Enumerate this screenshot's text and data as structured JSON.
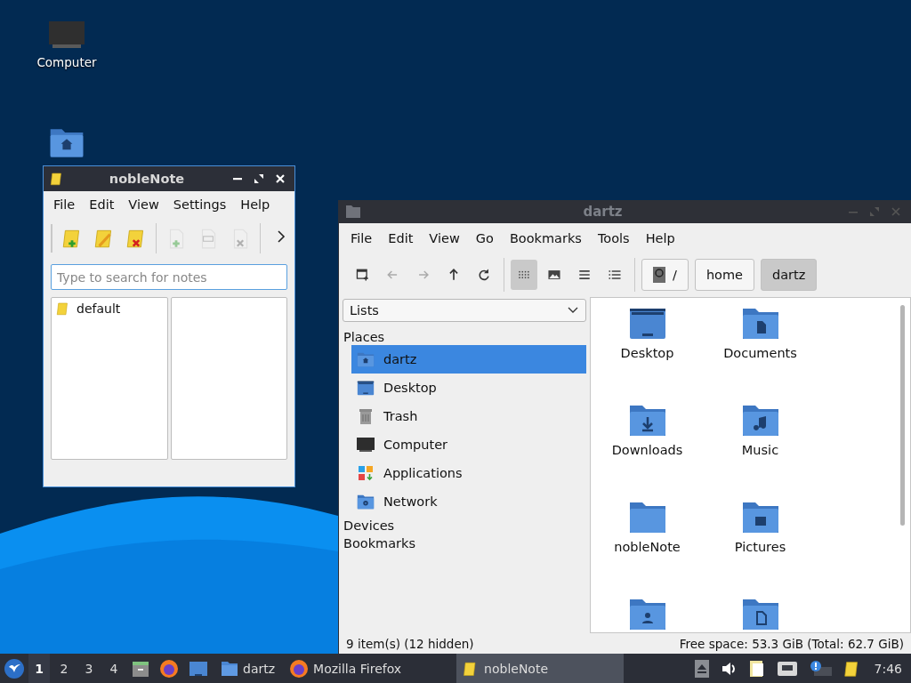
{
  "desktop": {
    "icons": [
      {
        "kind": "computer",
        "label": "Computer"
      },
      {
        "kind": "home"
      }
    ]
  },
  "notes_window": {
    "title": "nobleNote",
    "menu": [
      "File",
      "Edit",
      "View",
      "Settings",
      "Help"
    ],
    "toolbar": [
      {
        "kind": "new-folder",
        "disabled": false
      },
      {
        "kind": "rename-folder",
        "disabled": false
      },
      {
        "kind": "delete-folder",
        "disabled": false
      },
      {
        "kind": "new-note",
        "disabled": true
      },
      {
        "kind": "rename-note",
        "disabled": true
      },
      {
        "kind": "delete-note",
        "disabled": true
      }
    ],
    "search": {
      "placeholder": "Type to search for notes"
    },
    "folders": [
      {
        "name": "default",
        "selected": false
      }
    ]
  },
  "files_window": {
    "title": "dartz",
    "menu": [
      "File",
      "Edit",
      "View",
      "Go",
      "Bookmarks",
      "Tools",
      "Help"
    ],
    "nav_buttons": [
      {
        "kind": "new-tab",
        "disabled": false
      },
      {
        "kind": "back",
        "disabled": true
      },
      {
        "kind": "forward",
        "disabled": true
      },
      {
        "kind": "up",
        "disabled": false
      },
      {
        "kind": "reload",
        "disabled": false
      }
    ],
    "view_buttons": [
      {
        "kind": "icons",
        "selected": true
      },
      {
        "kind": "thumbnails",
        "selected": false
      },
      {
        "kind": "compact",
        "selected": false
      },
      {
        "kind": "details",
        "selected": false
      }
    ],
    "path": [
      {
        "kind": "root",
        "label": "/",
        "selected": false
      },
      {
        "kind": "dir",
        "label": "home",
        "selected": false
      },
      {
        "kind": "dir",
        "label": "dartz",
        "selected": true
      }
    ],
    "side_panel": {
      "mode": "Lists",
      "sections": [
        {
          "title": "Places",
          "items": [
            {
              "kind": "home",
              "label": "dartz",
              "selected": true
            },
            {
              "kind": "desktop",
              "label": "Desktop",
              "selected": false
            },
            {
              "kind": "trash",
              "label": "Trash",
              "selected": false
            },
            {
              "kind": "computer",
              "label": "Computer",
              "selected": false
            },
            {
              "kind": "apps",
              "label": "Applications",
              "selected": false
            },
            {
              "kind": "network",
              "label": "Network",
              "selected": false
            }
          ]
        },
        {
          "title": "Devices"
        },
        {
          "title": "Bookmarks"
        }
      ]
    },
    "files": [
      {
        "kind": "desktop",
        "name": "Desktop"
      },
      {
        "kind": "documents",
        "name": "Documents"
      },
      {
        "kind": "downloads",
        "name": "Downloads"
      },
      {
        "kind": "music",
        "name": "Music"
      },
      {
        "kind": "plain",
        "name": "nobleNote"
      },
      {
        "kind": "pictures",
        "name": "Pictures"
      },
      {
        "kind": "public"
      },
      {
        "kind": "templates"
      }
    ],
    "status": {
      "items": "9 item(s) (12 hidden)",
      "space": "Free space: 53.3 GiB (Total: 62.7 GiB)"
    }
  },
  "taskbar": {
    "workspaces": [
      {
        "label": "1",
        "selected": true
      },
      {
        "label": "2",
        "selected": false
      },
      {
        "label": "3",
        "selected": false
      },
      {
        "label": "4",
        "selected": false
      }
    ],
    "tasks": [
      {
        "kind": "folder",
        "label": "dartz",
        "selected": false
      },
      {
        "kind": "firefox",
        "label": "Mozilla Firefox",
        "selected": false
      },
      {
        "kind": "note",
        "label": "nobleNote",
        "selected": true
      }
    ],
    "clock": "7:46"
  }
}
